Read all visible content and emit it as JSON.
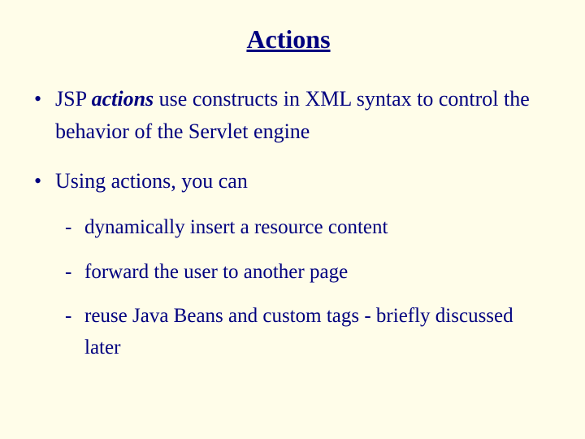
{
  "title": "Actions",
  "bullets": [
    {
      "prefix": "JSP ",
      "emph": "actions",
      "suffix": " use constructs in XML syntax to control the behavior of the Servlet engine"
    },
    {
      "text": "Using actions, you can",
      "sub": [
        "dynamically insert a resource content",
        "forward the user to another page",
        "reuse Java Beans and custom tags - briefly discussed later"
      ]
    }
  ]
}
